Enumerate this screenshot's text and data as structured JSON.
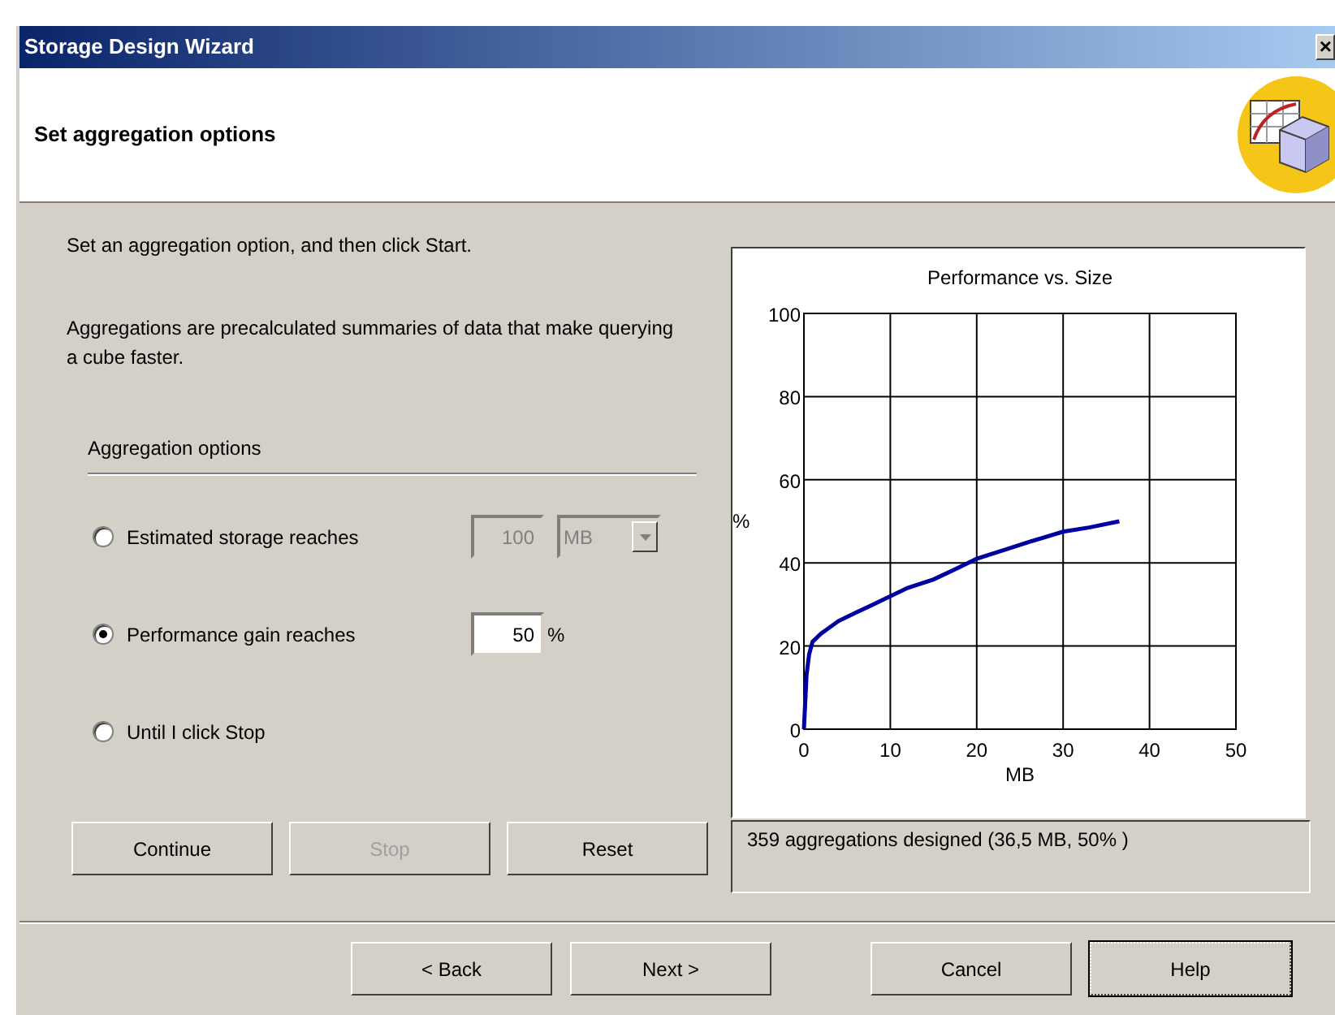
{
  "window": {
    "title": "Storage Design Wizard",
    "close": "×"
  },
  "header": {
    "title": "Set aggregation options"
  },
  "intro": "Set an aggregation option, and then click Start.",
  "description": "Aggregations are precalculated summaries of data that make querying a cube faster.",
  "options_group": {
    "title": "Aggregation options",
    "options": [
      {
        "kind": "storage",
        "label": "Estimated storage reaches",
        "selected": false,
        "value": "100",
        "unit": "MB",
        "disabled": true
      },
      {
        "kind": "performance",
        "label": "Performance gain reaches",
        "selected": true,
        "value": "50",
        "unit": "%",
        "disabled": false
      },
      {
        "kind": "manual",
        "label": "Until I click Stop",
        "selected": false
      }
    ]
  },
  "actions": [
    {
      "label": "Continue",
      "disabled": false
    },
    {
      "label": "Stop",
      "disabled": true
    },
    {
      "label": "Reset",
      "disabled": false
    }
  ],
  "chart": {
    "chart_data": {
      "type": "line",
      "title": "Performance vs. Size",
      "xlabel": "MB",
      "ylabel": "%",
      "x": [
        0,
        0.3,
        0.6,
        1,
        2,
        4,
        6,
        8,
        10,
        12,
        15,
        18,
        20,
        23,
        26,
        30,
        33,
        36.5
      ],
      "series": [
        {
          "color": "#0000a0",
          "values": [
            0,
            13,
            18,
            21,
            23,
            26,
            28,
            30,
            32,
            34,
            36,
            39,
            41,
            43,
            45,
            47.5,
            48.5,
            50
          ]
        }
      ],
      "xlim": [
        0,
        50
      ],
      "ylim": [
        0,
        100
      ],
      "xticks": [
        0,
        10,
        20,
        30,
        40,
        50
      ],
      "yticks": [
        0,
        20,
        40,
        60,
        80,
        100
      ],
      "grid": true
    }
  },
  "status": "359 aggregations designed (36,5 MB, 50% )",
  "footer_buttons": [
    {
      "label": "< Back",
      "default": false
    },
    {
      "label": "Next >",
      "default": false
    },
    {
      "label": "Cancel",
      "default": false
    },
    {
      "label": "Help",
      "default": true
    }
  ]
}
